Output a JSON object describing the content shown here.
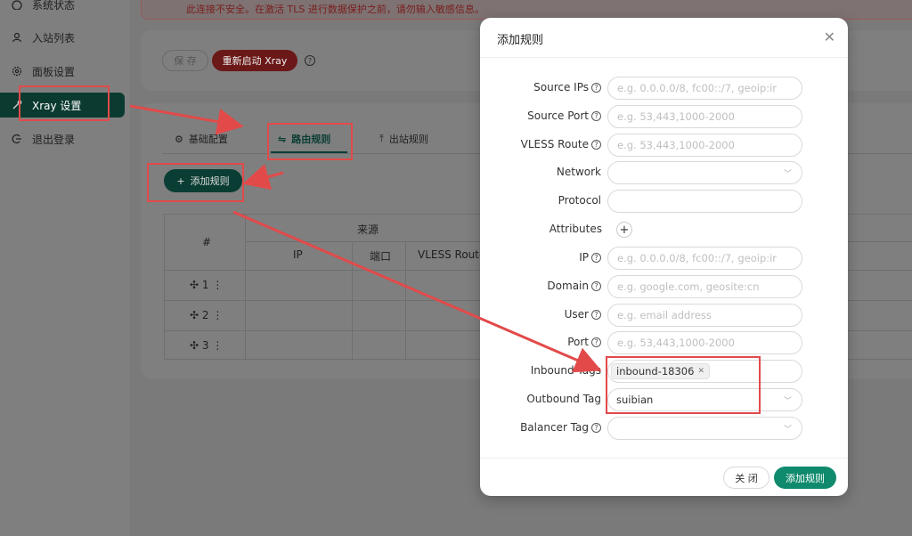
{
  "sidebar": {
    "items": [
      {
        "label": "系统状态",
        "icon": "dashboard-icon"
      },
      {
        "label": "入站列表",
        "icon": "user-icon"
      },
      {
        "label": "面板设置",
        "icon": "gear-icon"
      },
      {
        "label": "Xray 设置",
        "icon": "tool-icon"
      },
      {
        "label": "退出登录",
        "icon": "logout-icon"
      }
    ]
  },
  "alert": {
    "text": "此连接不安全。在激活 TLS 进行数据保护之前，请勿输入敏感信息。"
  },
  "toolbar": {
    "save_label": "保 存",
    "restart_label": "重新启动 Xray"
  },
  "tabs": [
    {
      "label": "基础配置"
    },
    {
      "label": "路由规则"
    },
    {
      "label": "出站规则"
    }
  ],
  "add_rule_label": "添加规则",
  "table": {
    "col_index": "#",
    "group_source": "来源",
    "cols": [
      "IP",
      "端口",
      "VLESS Route"
    ],
    "rows": [
      "1",
      "2",
      "3"
    ]
  },
  "modal": {
    "title": "添加规则",
    "fields": {
      "source_ips": {
        "label": "Source IPs",
        "placeholder": "e.g. 0.0.0.0/8, fc00::/7, geoip:ir"
      },
      "source_port": {
        "label": "Source Port",
        "placeholder": "e.g. 53,443,1000-2000"
      },
      "vless_route": {
        "label": "VLESS Route",
        "placeholder": "e.g. 53,443,1000-2000"
      },
      "network": {
        "label": "Network"
      },
      "protocol": {
        "label": "Protocol"
      },
      "attributes": {
        "label": "Attributes"
      },
      "ip": {
        "label": "IP",
        "placeholder": "e.g. 0.0.0.0/8, fc00::/7, geoip:ir"
      },
      "domain": {
        "label": "Domain",
        "placeholder": "e.g. google.com, geosite:cn"
      },
      "user": {
        "label": "User",
        "placeholder": "e.g. email address"
      },
      "port": {
        "label": "Port",
        "placeholder": "e.g. 53,443,1000-2000"
      },
      "inbound_tags": {
        "label": "Inbound Tags",
        "tag": "inbound-18306"
      },
      "outbound_tag": {
        "label": "Outbound Tag",
        "value": "suibian"
      },
      "balancer_tag": {
        "label": "Balancer Tag"
      }
    },
    "cancel_label": "关 闭",
    "ok_label": "添加规则"
  },
  "colors": {
    "primary": "#0f8a6c",
    "annotation": "#e24a4a",
    "danger": "#6b1818"
  }
}
